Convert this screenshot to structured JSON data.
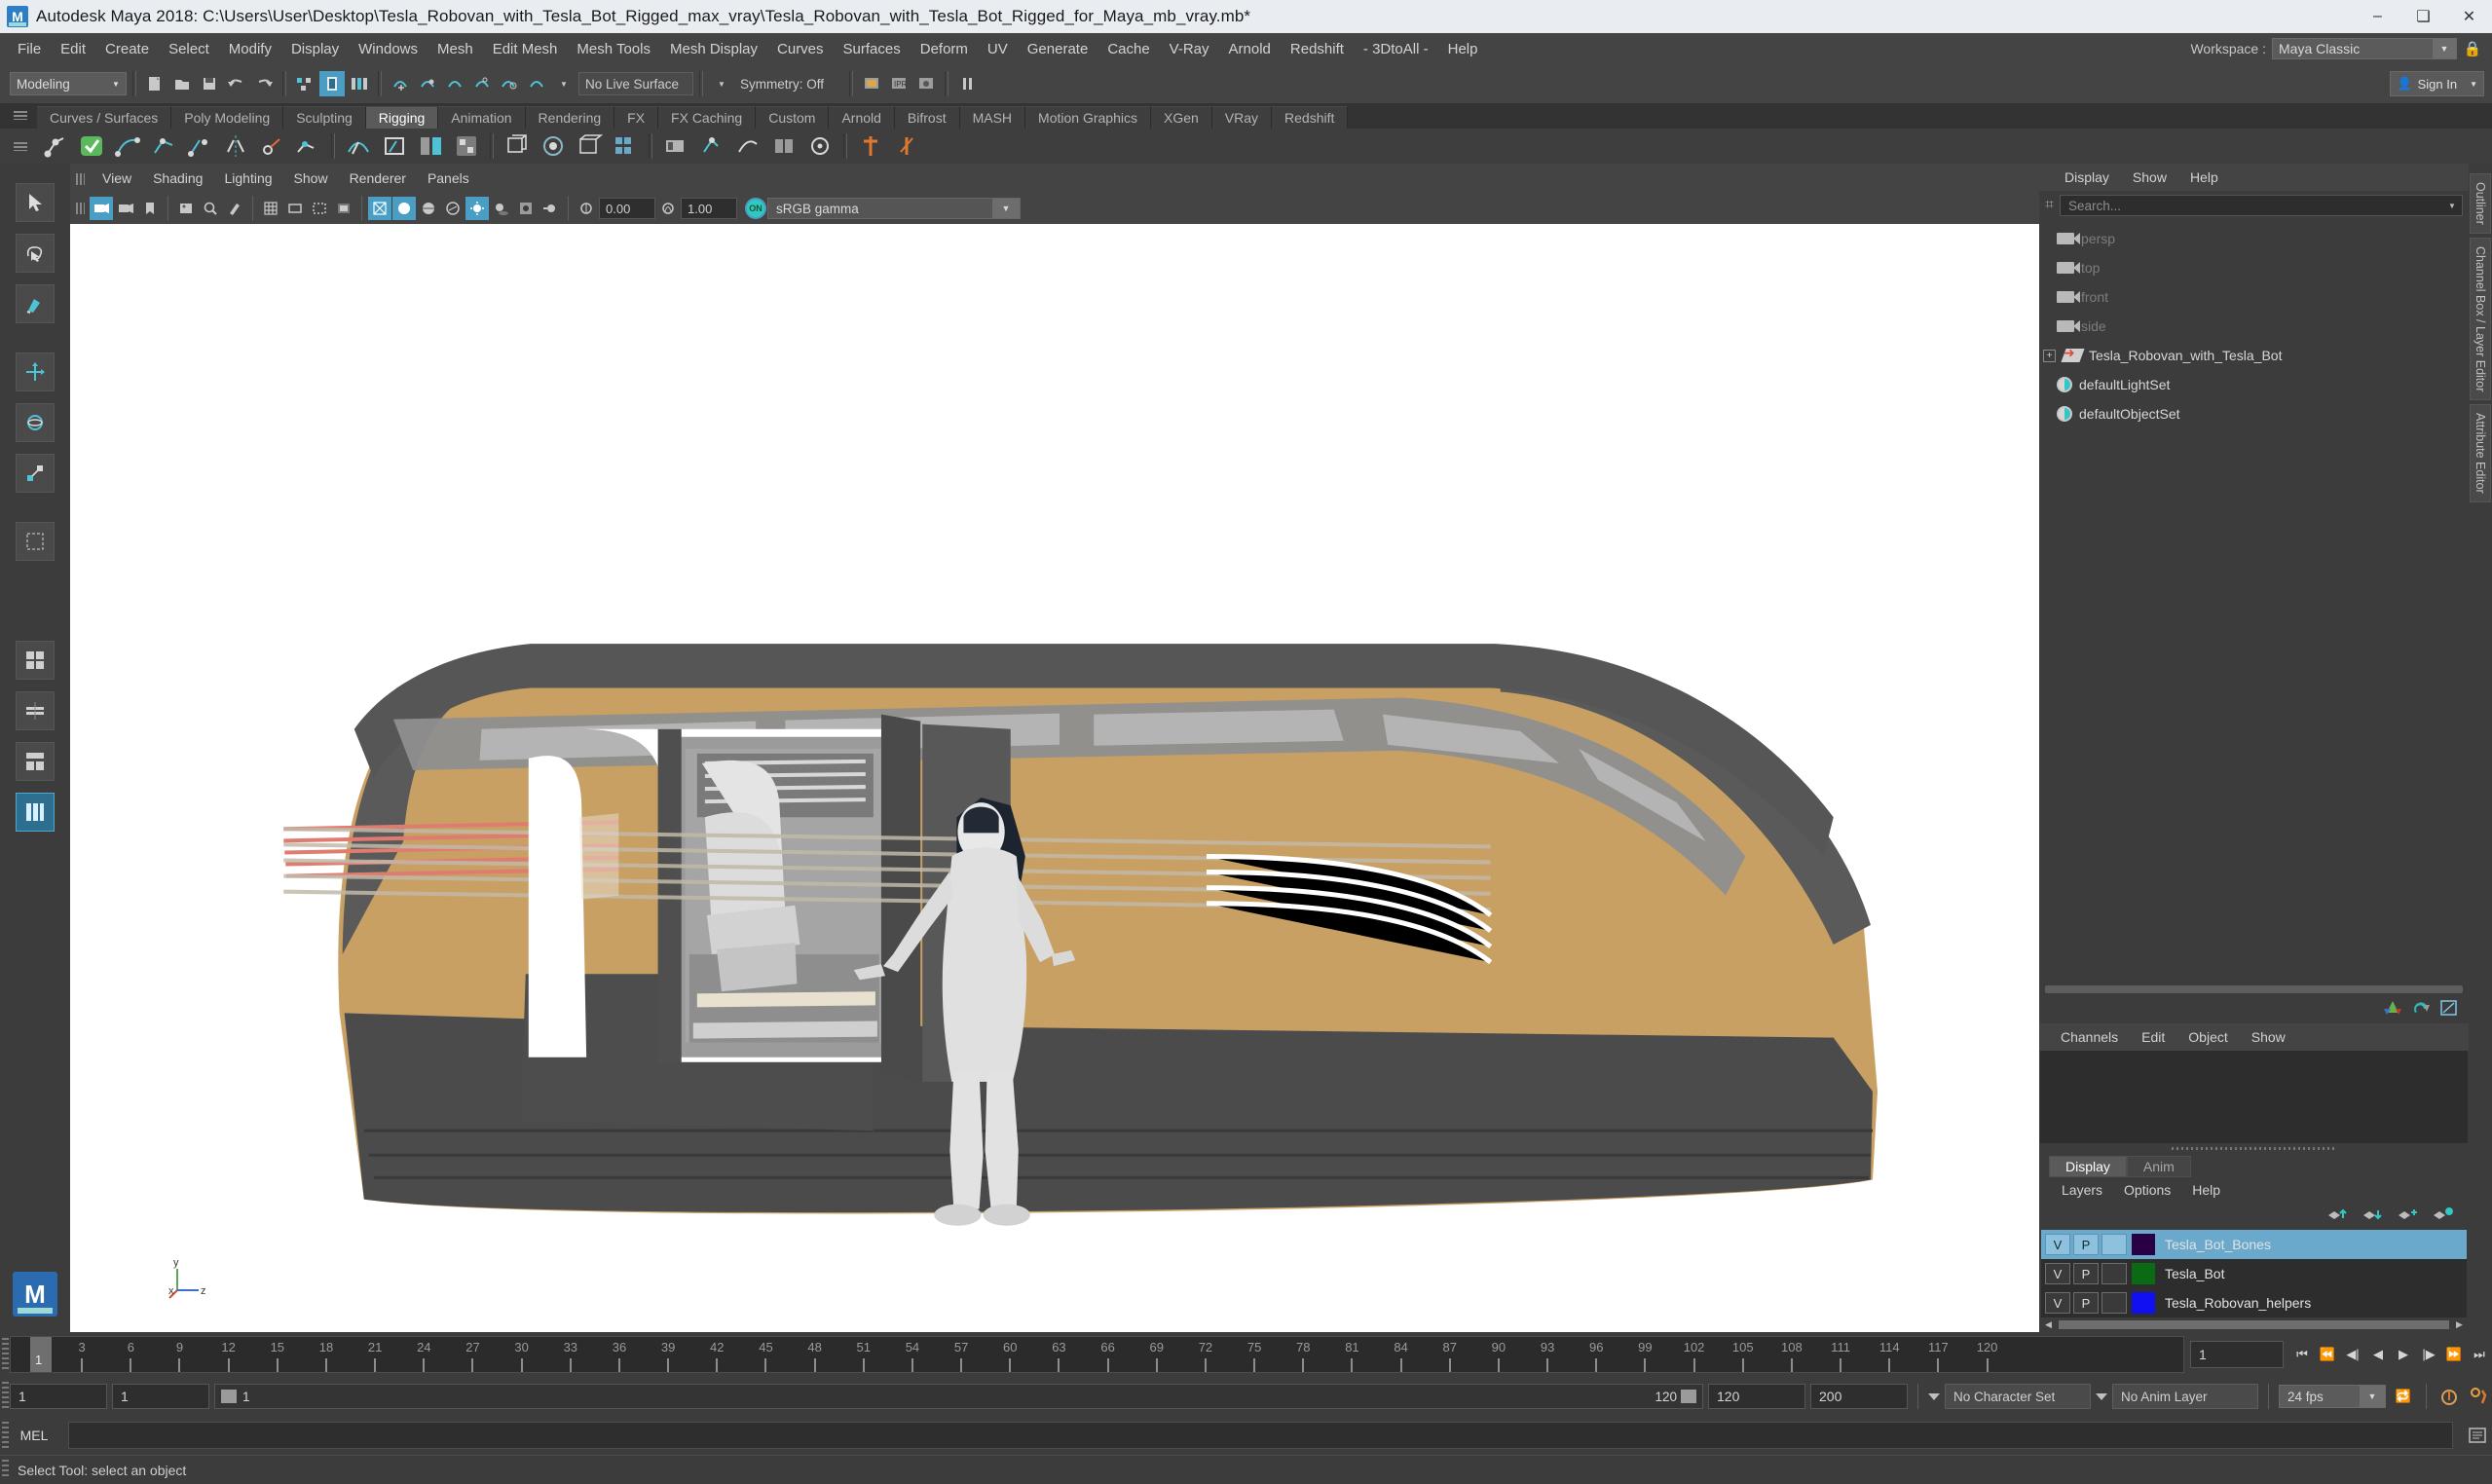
{
  "window": {
    "title": "Autodesk Maya 2018: C:\\Users\\User\\Desktop\\Tesla_Robovan_with_Tesla_Bot_Rigged_max_vray\\Tesla_Robovan_with_Tesla_Bot_Rigged_for_Maya_mb_vray.mb*",
    "minimize": "–",
    "maximize": "❑",
    "close": "✕",
    "app_icon": "maya-logo-icon"
  },
  "menubar": {
    "items": [
      "File",
      "Edit",
      "Create",
      "Select",
      "Modify",
      "Display",
      "Windows",
      "Mesh",
      "Edit Mesh",
      "Mesh Tools",
      "Mesh Display",
      "Curves",
      "Surfaces",
      "Deform",
      "UV",
      "Generate",
      "Cache",
      "V-Ray",
      "Arnold",
      "Redshift",
      "- 3DtoAll -",
      "Help"
    ],
    "workspace_label": "Workspace :",
    "workspace_value": "Maya Classic",
    "lock_icon": "lock-icon"
  },
  "statusline": {
    "mode_menu": "Modeling",
    "live_surface": "No Live Surface",
    "symmetry": "Symmetry: Off",
    "sign_in": "Sign In",
    "icons": [
      "new-scene-icon",
      "open-scene-icon",
      "save-scene-icon",
      "undo-icon",
      "redo-icon",
      "select-by-hierarchy-icon",
      "select-by-object-icon",
      "select-by-component-icon",
      "snap-to-grid-icon",
      "snap-to-curve-icon",
      "snap-to-point-icon",
      "snap-to-projected-center-icon",
      "snap-to-view-plane-icon",
      "make-live-icon",
      "render-current-frame-icon",
      "ipr-render-icon",
      "render-settings-icon",
      "pause-icon",
      "user-icon"
    ]
  },
  "shelf": {
    "tabs": [
      "Curves / Surfaces",
      "Poly Modeling",
      "Sculpting",
      "Rigging",
      "Animation",
      "Rendering",
      "FX",
      "FX Caching",
      "Custom",
      "Arnold",
      "Bifrost",
      "MASH",
      "Motion Graphics",
      "XGen",
      "VRay",
      "Redshift"
    ],
    "active_tab": "Rigging",
    "buttons": [
      "joint-tool-icon",
      "ik-handle-icon",
      "ik-spline-handle-icon",
      "ik-rp-handle-icon",
      "insert-joint-icon",
      "mirror-joint-icon",
      "orient-joint-icon",
      "connect-joint-icon",
      "smooth-bind-icon",
      "rigid-bind-icon",
      "detach-skin-icon",
      "paint-skin-weights-icon",
      "lattice-icon",
      "wrap-deformer-icon",
      "cluster-icon",
      "wire-tool-icon",
      "blend-shape-icon",
      "create-deformer-icon",
      "parent-constraint-icon",
      "point-constraint-icon",
      "aim-constraint-icon",
      "orient-constraint-icon",
      "scale-constraint-icon",
      "pole-vector-icon",
      "set-key-icon",
      "set-driven-key-icon"
    ]
  },
  "toolbox": {
    "tools": [
      "select-tool",
      "lasso-select-tool",
      "paint-select-tool",
      "move-tool",
      "rotate-tool",
      "scale-tool",
      "show-manipulator-tool",
      "last-tool-used",
      "single-perspective-view",
      "four-view-layout",
      "persp-outliner-layout",
      "persp-graph-layout"
    ],
    "active_tool": "select-tool",
    "logo": "maya-logo-icon"
  },
  "viewport": {
    "menu": [
      "View",
      "Shading",
      "Lighting",
      "Show",
      "Renderer",
      "Panels"
    ],
    "toolbar": {
      "exposure_value": "0.00",
      "gamma_value": "1.00",
      "color_space": "sRGB gamma",
      "gamma_toggle": "ON",
      "icons": [
        "select-camera-icon",
        "camera-attributes-icon",
        "bookmarks-icon",
        "image-plane-icon",
        "two-d-pan-zoom-icon",
        "grease-pencil-icon",
        "grid-icon",
        "film-gate-icon",
        "resolution-gate-icon",
        "gate-mask-icon",
        "viewport-settings-icon",
        "exposure-icon",
        "gamma-icon",
        "wireframe-icon",
        "smooth-shade-icon",
        "shaded-wireframe-icon",
        "textured-icon",
        "use-all-lights-icon",
        "shadows-icon",
        "screen-space-ao-icon",
        "motion-blur-icon",
        "multisample-icon",
        "depth-of-field-icon",
        "isolate-select-icon",
        "xray-icon",
        "xray-joints-icon"
      ]
    },
    "gizmo": {
      "y": "y",
      "x": "x",
      "z": "z"
    }
  },
  "outliner": {
    "menu": [
      "Display",
      "Show",
      "Help"
    ],
    "search_placeholder": "Search...",
    "search_icon": "outliner-search-icon",
    "items": [
      {
        "label": "persp",
        "icon": "camera-icon",
        "type": "camera",
        "dim": true,
        "expandable": false
      },
      {
        "label": "top",
        "icon": "camera-icon",
        "type": "camera",
        "dim": true,
        "expandable": false
      },
      {
        "label": "front",
        "icon": "camera-icon",
        "type": "camera",
        "dim": true,
        "expandable": false
      },
      {
        "label": "side",
        "icon": "camera-icon",
        "type": "camera",
        "dim": true,
        "expandable": false
      },
      {
        "label": "Tesla_Robovan_with_Tesla_Bot",
        "icon": "group-icon",
        "type": "group",
        "dim": false,
        "expandable": true
      },
      {
        "label": "defaultLightSet",
        "icon": "set-icon",
        "type": "set",
        "dim": false,
        "expandable": false
      },
      {
        "label": "defaultObjectSet",
        "icon": "set-icon",
        "type": "set",
        "dim": false,
        "expandable": false
      }
    ]
  },
  "channelbox": {
    "menu": [
      "Channels",
      "Edit",
      "Object",
      "Show"
    ],
    "toolbar_icons": [
      "channel-box-icon",
      "attribute-editor-icon",
      "modeling-toolkit-icon"
    ]
  },
  "layereditor": {
    "tabs": [
      "Display",
      "Anim"
    ],
    "active_tab": "Display",
    "menu": [
      "Layers",
      "Options",
      "Help"
    ],
    "buttons": [
      "move-layer-up-icon",
      "move-layer-down-icon",
      "create-empty-layer-icon",
      "create-layer-from-selected-icon"
    ],
    "columns": {
      "visibility": "V",
      "playback": "P"
    },
    "layers": [
      {
        "v": "V",
        "p": "P",
        "third": "",
        "color": "#2a0045",
        "name": "Tesla_Bot_Bones",
        "selected": true
      },
      {
        "v": "V",
        "p": "P",
        "third": "",
        "color": "#0a6b14",
        "name": "Tesla_Bot",
        "selected": false
      },
      {
        "v": "V",
        "p": "P",
        "third": "",
        "color": "#1010f0",
        "name": "Tesla_Robovan_helpers",
        "selected": false
      }
    ]
  },
  "sidetabs": {
    "right": [
      "Outliner",
      "Channel Box / Layer Editor",
      "Attribute Editor"
    ]
  },
  "timeline": {
    "ticks": [
      3,
      6,
      9,
      12,
      15,
      18,
      21,
      24,
      27,
      30,
      33,
      36,
      39,
      42,
      45,
      48,
      51,
      54,
      57,
      60,
      63,
      66,
      69,
      72,
      75,
      78,
      81,
      84,
      87,
      90,
      93,
      96,
      99,
      102,
      105,
      108,
      111,
      114,
      117,
      120
    ],
    "current_frame_marker": "1",
    "current_frame_field": "1",
    "playback_buttons": [
      "go-to-start-icon",
      "step-back-frame-icon",
      "step-back-key-icon",
      "play-backwards-icon",
      "play-forwards-icon",
      "step-forward-key-icon",
      "step-forward-frame-icon",
      "go-to-end-icon"
    ]
  },
  "rangeslider": {
    "anim_start": "1",
    "playback_start": "1",
    "playback_end_inline": "1",
    "playback_end": "120",
    "range_end_field": "120",
    "anim_end_field": "200",
    "character_set": "No Character Set",
    "anim_layer": "No Anim Layer",
    "fps": "24 fps",
    "icons": [
      "auto-key-icon",
      "animation-preferences-icon",
      "playback-loop-icon"
    ]
  },
  "commandline": {
    "language_label": "MEL",
    "input_value": "",
    "script_editor_icon": "script-editor-icon"
  },
  "helpline": {
    "text": "Select Tool: select an object"
  },
  "colors": {
    "accent_blue": "#4a9ec4",
    "shelf_bg": "#3e3e3e",
    "panel_bg": "#3c3c3c",
    "viewport_bg": "#ffffff",
    "selection_blue": "#6aa9cc",
    "model_body": "#c9a063",
    "model_dark": "#4a4a4a"
  }
}
